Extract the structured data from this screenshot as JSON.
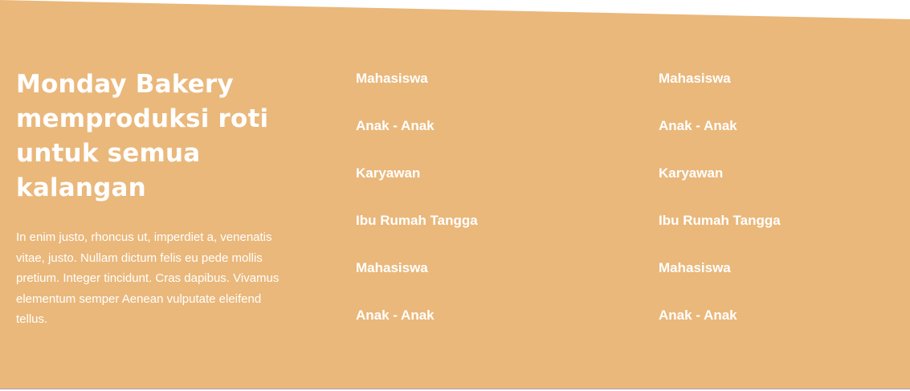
{
  "colors": {
    "section_background": "#eab87b",
    "text": "#ffffff"
  },
  "intro": {
    "headline": "Monday Bakery memproduksi roti untuk semua kalangan",
    "description": "In enim justo, rhoncus ut, imperdiet a, venenatis vitae, justo. Nullam dictum felis eu pede mollis pretium. Integer tincidunt. Cras dapibus. Vivamus elementum semper Aenean vulputate eleifend tellus."
  },
  "list_a": {
    "items": [
      {
        "label": "Mahasiswa"
      },
      {
        "label": "Anak - Anak"
      },
      {
        "label": "Karyawan"
      },
      {
        "label": "Ibu Rumah Tangga"
      },
      {
        "label": "Mahasiswa"
      },
      {
        "label": "Anak - Anak"
      }
    ]
  },
  "list_b": {
    "items": [
      {
        "label": "Mahasiswa"
      },
      {
        "label": "Anak - Anak"
      },
      {
        "label": "Karyawan"
      },
      {
        "label": "Ibu Rumah Tangga"
      },
      {
        "label": "Mahasiswa"
      },
      {
        "label": "Anak - Anak"
      }
    ]
  }
}
